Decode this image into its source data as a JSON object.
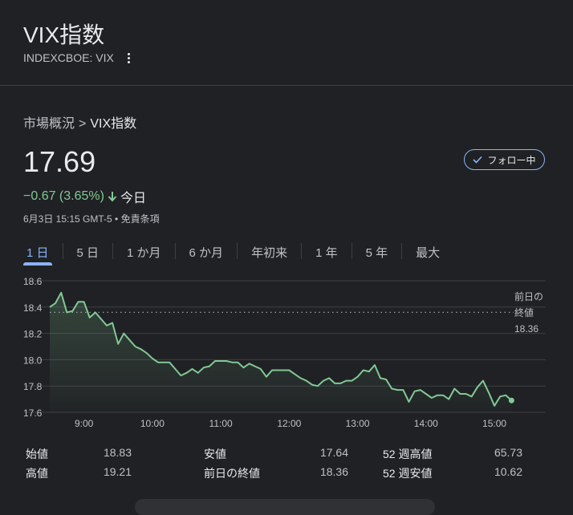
{
  "header": {
    "title": "VIX指数",
    "ticker": "INDEXCBOE: VIX"
  },
  "breadcrumb": {
    "parent": "市場概況",
    "separator": ">",
    "current": "VIX指数"
  },
  "quote": {
    "price": "17.69",
    "change": "−0.67 (3.65%)",
    "period": "今日",
    "timestamp": "6月3日 15:15 GMT-5 • 免責条項",
    "follow_label": "フォロー中"
  },
  "tabs": [
    {
      "label": "1 日",
      "active": true
    },
    {
      "label": "5 日",
      "active": false
    },
    {
      "label": "1 か月",
      "active": false
    },
    {
      "label": "6 か月",
      "active": false
    },
    {
      "label": "年初来",
      "active": false
    },
    {
      "label": "1 年",
      "active": false
    },
    {
      "label": "5 年",
      "active": false
    },
    {
      "label": "最大",
      "active": false
    }
  ],
  "chart_data": {
    "type": "line",
    "title": "",
    "xlabel": "",
    "ylabel": "",
    "x_ticks": [
      "9:00",
      "10:00",
      "11:00",
      "12:00",
      "13:00",
      "14:00",
      "15:00"
    ],
    "y_ticks": [
      "18.6",
      "18.4",
      "18.2",
      "18.0",
      "17.8",
      "17.6"
    ],
    "ylim": [
      17.6,
      18.6
    ],
    "xlim": [
      "8:30",
      "15:45"
    ],
    "grid": true,
    "line_color": "#81c995",
    "previous_close": {
      "label_lines": [
        "前日の",
        "終値",
        "18.36"
      ],
      "value": 18.36
    },
    "series": [
      {
        "x": [
          "8:30",
          "8:35",
          "8:40",
          "8:45",
          "8:50",
          "8:55",
          "9:00",
          "9:05",
          "9:10",
          "9:15",
          "9:20",
          "9:25",
          "9:30",
          "9:35",
          "9:40",
          "9:45",
          "9:50",
          "9:55",
          "10:00",
          "10:05",
          "10:10",
          "10:15",
          "10:20",
          "10:25",
          "10:30",
          "10:35",
          "10:40",
          "10:45",
          "10:50",
          "10:55",
          "11:00",
          "11:05",
          "11:10",
          "11:15",
          "11:20",
          "11:25",
          "11:30",
          "11:35",
          "11:40",
          "11:45",
          "11:50",
          "11:55",
          "12:00",
          "12:05",
          "12:10",
          "12:15",
          "12:20",
          "12:25",
          "12:30",
          "12:35",
          "12:40",
          "12:45",
          "12:50",
          "12:55",
          "13:00",
          "13:05",
          "13:10",
          "13:15",
          "13:20",
          "13:25",
          "13:30",
          "13:35",
          "13:40",
          "13:45",
          "13:50",
          "13:55",
          "14:00",
          "14:05",
          "14:10",
          "14:15",
          "14:20",
          "14:25",
          "14:30",
          "14:35",
          "14:40",
          "14:45",
          "14:50",
          "14:55",
          "15:00",
          "15:05",
          "15:10",
          "15:15"
        ],
        "values": [
          18.4,
          18.43,
          18.51,
          18.36,
          18.37,
          18.44,
          18.44,
          18.32,
          18.36,
          18.31,
          18.26,
          18.28,
          18.12,
          18.2,
          18.15,
          18.1,
          18.08,
          18.05,
          18.01,
          17.98,
          17.98,
          17.98,
          17.93,
          17.88,
          17.9,
          17.93,
          17.9,
          17.94,
          17.95,
          17.99,
          17.99,
          17.99,
          17.98,
          17.98,
          17.94,
          17.97,
          17.95,
          17.93,
          17.87,
          17.92,
          17.92,
          17.92,
          17.92,
          17.89,
          17.86,
          17.84,
          17.81,
          17.8,
          17.84,
          17.86,
          17.82,
          17.82,
          17.84,
          17.84,
          17.87,
          17.92,
          17.91,
          17.96,
          17.86,
          17.85,
          17.78,
          17.77,
          17.77,
          17.68,
          17.76,
          17.77,
          17.74,
          17.71,
          17.73,
          17.73,
          17.7,
          17.78,
          17.74,
          17.74,
          17.72,
          17.79,
          17.84,
          17.75,
          17.65,
          17.72,
          17.73,
          17.69
        ]
      }
    ]
  },
  "stats": {
    "col1": [
      {
        "label": "始値",
        "value": "18.83"
      },
      {
        "label": "高値",
        "value": "19.21"
      }
    ],
    "col2": [
      {
        "label": "安値",
        "value": "17.64"
      },
      {
        "label": "前日の終値",
        "value": "18.36"
      }
    ],
    "col3": [
      {
        "label": "52 週高値",
        "value": "65.73"
      },
      {
        "label": "52 週安値",
        "value": "10.62"
      }
    ]
  }
}
